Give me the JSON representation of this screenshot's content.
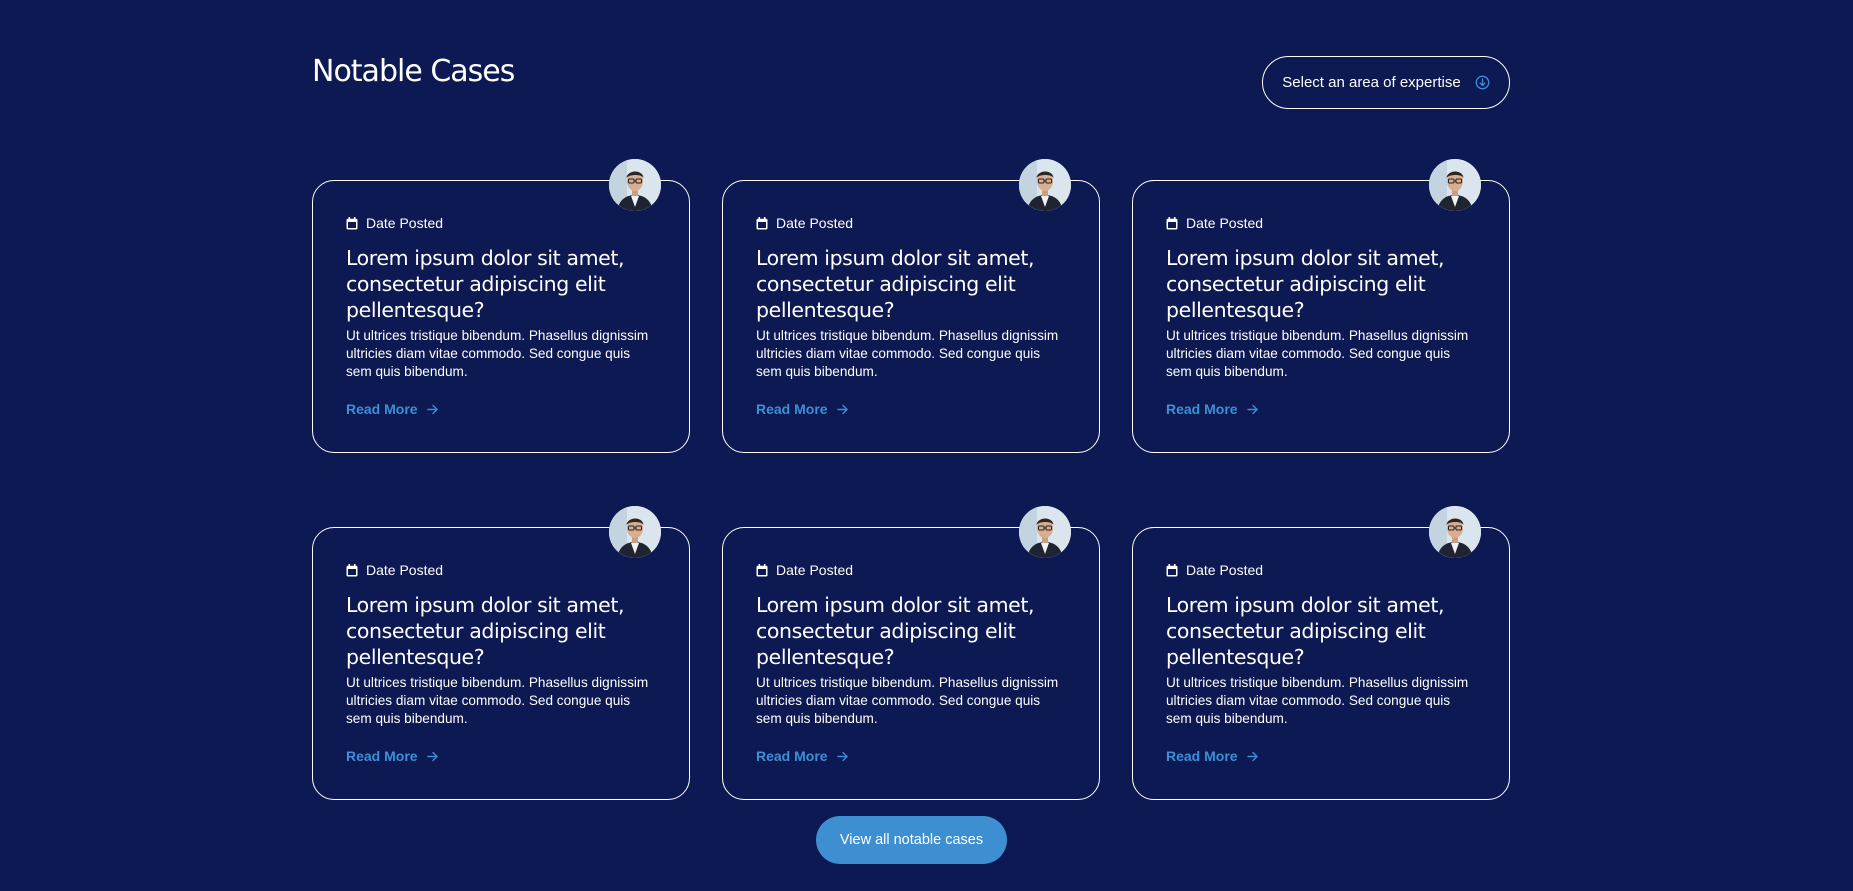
{
  "section": {
    "title": "Notable Cases"
  },
  "filter": {
    "label": "Select an area of expertise",
    "icon": "arrow-down-circle-icon"
  },
  "cards": [
    {
      "date_label": "Date Posted",
      "title": "Lorem ipsum dolor sit amet, consectetur adipiscing elit pellentesque?",
      "excerpt": "Ut ultrices tristique bibendum. Phasellus dignissim ultricies diam vitae commodo. Sed congue quis sem quis bibendum.",
      "read_more": "Read More"
    },
    {
      "date_label": "Date Posted",
      "title": "Lorem ipsum dolor sit amet, consectetur adipiscing elit pellentesque?",
      "excerpt": "Ut ultrices tristique bibendum. Phasellus dignissim ultricies diam vitae commodo. Sed congue quis sem quis bibendum.",
      "read_more": "Read More"
    },
    {
      "date_label": "Date Posted",
      "title": "Lorem ipsum dolor sit amet, consectetur adipiscing elit pellentesque?",
      "excerpt": "Ut ultrices tristique bibendum. Phasellus dignissim ultricies diam vitae commodo. Sed congue quis sem quis bibendum.",
      "read_more": "Read More"
    },
    {
      "date_label": "Date Posted",
      "title": "Lorem ipsum dolor sit amet, consectetur adipiscing elit pellentesque?",
      "excerpt": "Ut ultrices tristique bibendum. Phasellus dignissim ultricies diam vitae commodo. Sed congue quis sem quis bibendum.",
      "read_more": "Read More"
    },
    {
      "date_label": "Date Posted",
      "title": "Lorem ipsum dolor sit amet, consectetur adipiscing elit pellentesque?",
      "excerpt": "Ut ultrices tristique bibendum. Phasellus dignissim ultricies diam vitae commodo. Sed congue quis sem quis bibendum.",
      "read_more": "Read More"
    },
    {
      "date_label": "Date Posted",
      "title": "Lorem ipsum dolor sit amet, consectetur adipiscing elit pellentesque?",
      "excerpt": "Ut ultrices tristique bibendum. Phasellus dignissim ultricies diam vitae commodo. Sed congue quis sem quis bibendum.",
      "read_more": "Read More"
    }
  ],
  "view_all": {
    "label": "View all notable cases"
  },
  "colors": {
    "background": "#0c1952",
    "accent": "#3d8fd8",
    "button": "#3d8fd1",
    "text": "#ffffff"
  },
  "icons": {
    "calendar": "calendar-icon",
    "arrow": "arrow-right-icon",
    "avatar": "avatar"
  }
}
